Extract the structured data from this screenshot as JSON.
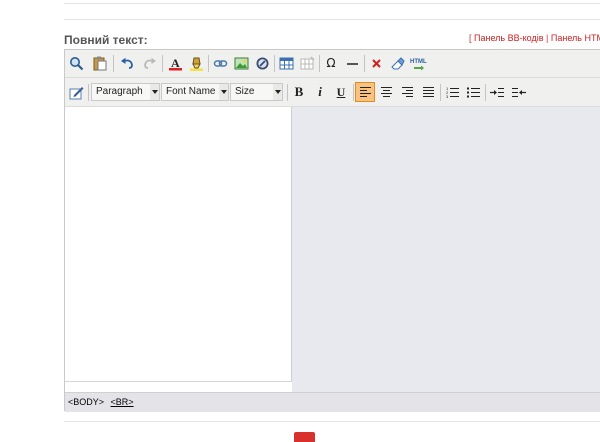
{
  "field_label": "Повний текст:",
  "panel_links": {
    "open_bracket": "[",
    "bb_panel": "Панель BB-кодів",
    "divider": "|",
    "html_panel": "Панель HTM"
  },
  "toolbar": {
    "format_select": "Paragraph",
    "font_select": "Font Name",
    "size_select": "Size",
    "bold_label": "B",
    "italic_label": "i",
    "underline_label": "U",
    "omega_label": "Ω",
    "html_label": "HTML",
    "active_align": "left"
  },
  "status_path": {
    "body_tag": "<BODY>",
    "br_tag": "<BR>"
  },
  "colors": {
    "link_red": "#cc2222",
    "toolbar_bg": "#f0f0ee",
    "active_button": "#f9c27f",
    "submit_red": "#d9302d"
  }
}
